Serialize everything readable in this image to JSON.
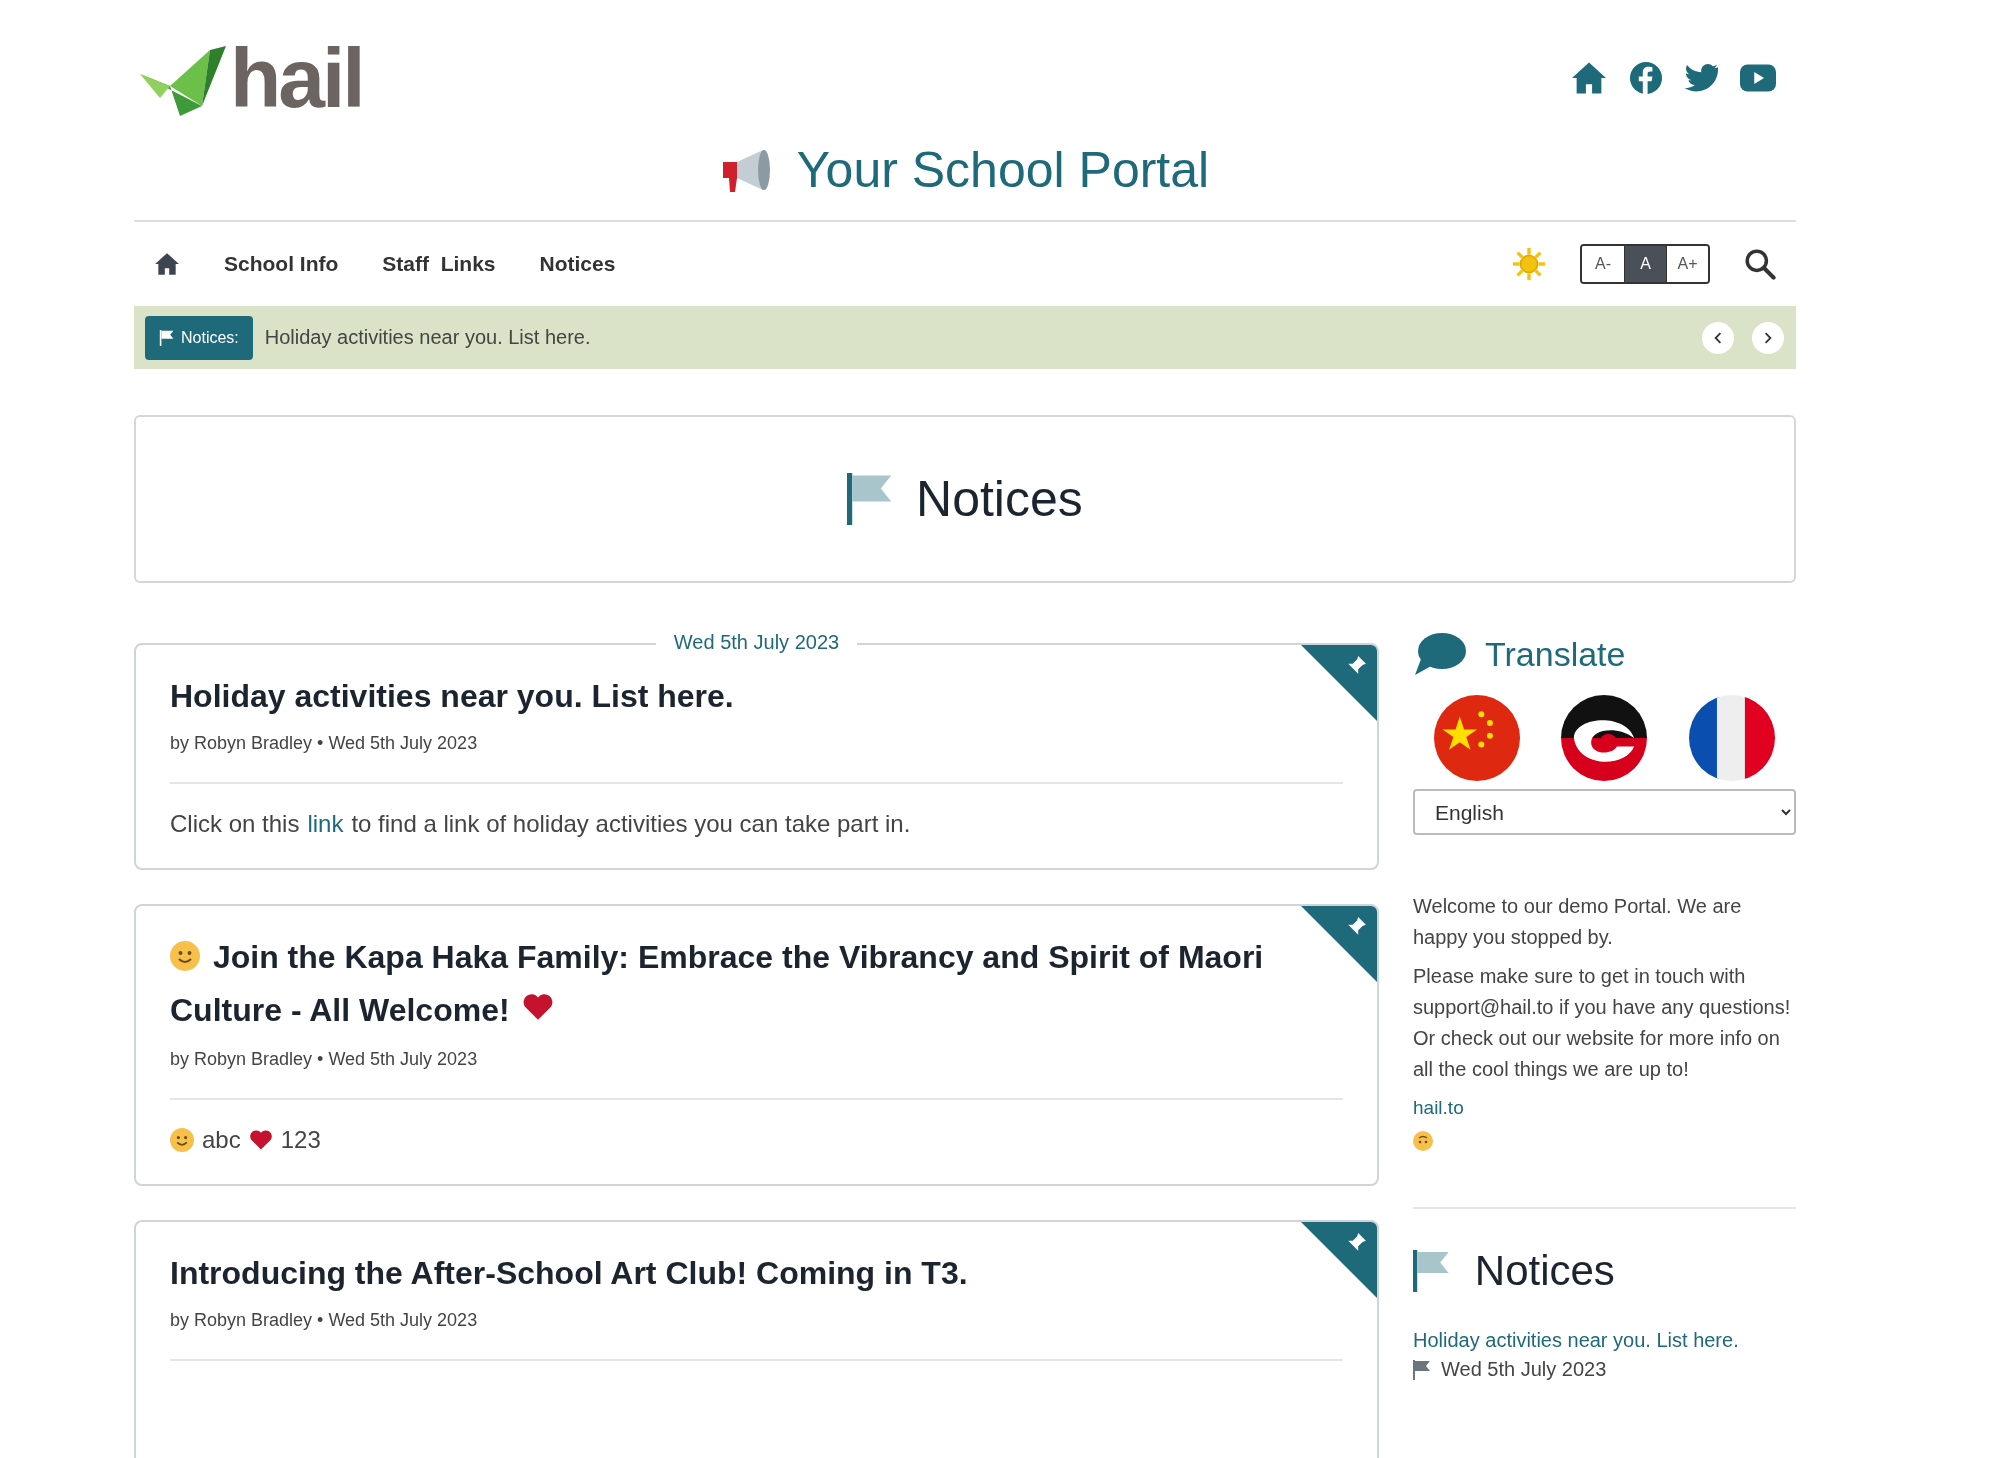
{
  "header": {
    "logo": "hail",
    "title": "Your School Portal"
  },
  "nav": {
    "items": [
      {
        "label": "School Info"
      },
      {
        "label": "Staff  Links"
      },
      {
        "label": "Notices"
      }
    ],
    "font_sizes": [
      {
        "label": "A-",
        "selected": false
      },
      {
        "label": "A",
        "selected": true
      },
      {
        "label": "A+",
        "selected": false
      }
    ]
  },
  "ticker": {
    "badge": "Notices:",
    "text": "Holiday activities near you. List here."
  },
  "hero": {
    "title": "Notices"
  },
  "date_divider": "Wed 5th July 2023",
  "notices": [
    {
      "title": [
        {
          "kind": "text",
          "text": "Holiday activities near you. List here."
        }
      ],
      "meta": "by Robyn Bradley • Wed 5th July 2023",
      "body": [
        {
          "kind": "text",
          "text": "Click on this "
        },
        {
          "kind": "link",
          "text": "link"
        },
        {
          "kind": "text",
          "text": " to find a link of holiday activities you can take part in."
        }
      ]
    },
    {
      "title": [
        {
          "kind": "smiley"
        },
        {
          "kind": "text",
          "text": "Join the Kapa Haka Family: Embrace the Vibrancy and Spirit of Maori Culture - All Welcome!"
        },
        {
          "kind": "heart"
        }
      ],
      "meta": "by Robyn Bradley • Wed 5th July 2023",
      "body": [
        {
          "kind": "smiley"
        },
        {
          "kind": "text",
          "text": "abc"
        },
        {
          "kind": "heart"
        },
        {
          "kind": "text",
          "text": "123"
        }
      ]
    },
    {
      "title": [
        {
          "kind": "text",
          "text": "Introducing the After-School Art Club! Coming in T3."
        }
      ],
      "meta": "by Robyn Bradley • Wed 5th July 2023"
    }
  ],
  "sidebar": {
    "translate": {
      "title": "Translate",
      "language": "English"
    },
    "welcome": [
      "Welcome to our demo Portal. We are happy you stopped by.",
      "Please make sure to get in touch with support@hail.to if you have any questions! Or check out our website for more info on all the cool things we are up to!"
    ],
    "website_link": "hail.to",
    "notices": {
      "title": "Notices",
      "items": [
        {
          "title": "Holiday activities near you. List here.",
          "date": "Wed 5th July 2023"
        }
      ]
    }
  }
}
